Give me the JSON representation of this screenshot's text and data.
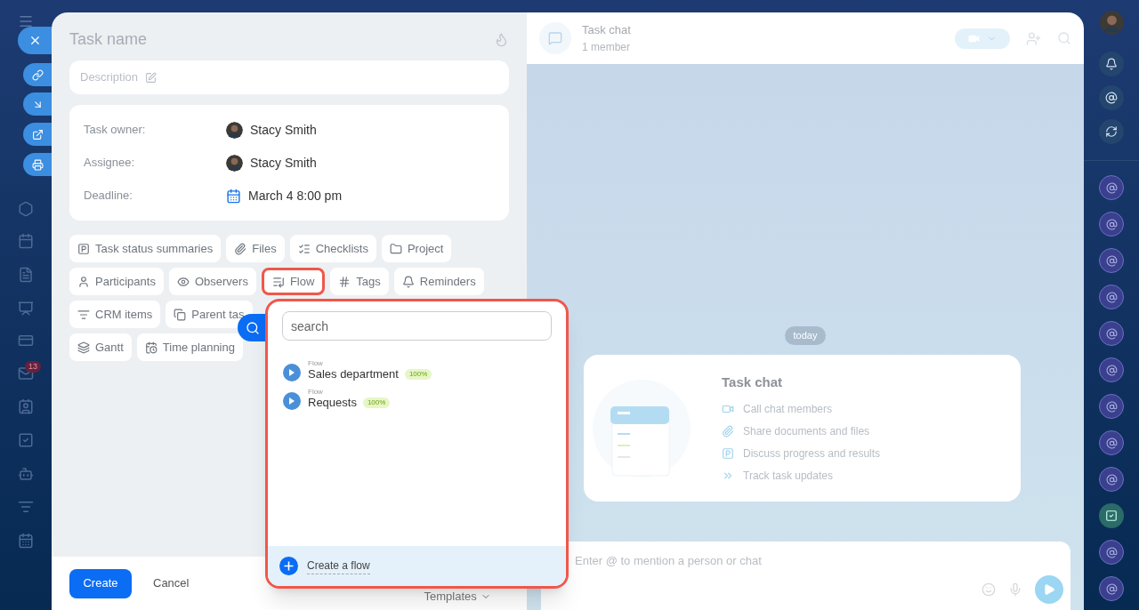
{
  "sidebar": {
    "mail_badge": "13"
  },
  "task": {
    "title_placeholder": "Task name",
    "description_placeholder": "Description",
    "fields": [
      {
        "label": "Task owner:",
        "value": "Stacy Smith",
        "kind": "person"
      },
      {
        "label": "Assignee:",
        "value": "Stacy Smith",
        "kind": "person"
      },
      {
        "label": "Deadline:",
        "value": "March 4 8:00 pm",
        "kind": "date"
      }
    ]
  },
  "chip_rows": [
    [
      {
        "label": "Task status summaries",
        "selected": false
      },
      {
        "label": "Files",
        "selected": false
      },
      {
        "label": "Checklists",
        "selected": false
      },
      {
        "label": "Project",
        "selected": false
      }
    ],
    [
      {
        "label": "Participants",
        "selected": false
      },
      {
        "label": "Observers",
        "selected": false
      },
      {
        "label": "Flow",
        "selected": true
      },
      {
        "label": "Tags",
        "selected": false
      },
      {
        "label": "Reminders",
        "selected": false
      }
    ],
    [
      {
        "label": "CRM items",
        "selected": false
      },
      {
        "label": "Parent tas",
        "selected": false
      }
    ],
    [
      {
        "label": "Gantt",
        "selected": false
      },
      {
        "label": "Time planning",
        "selected": false
      }
    ]
  ],
  "flow_dropdown": {
    "search_placeholder": "search",
    "items": [
      {
        "caption": "Flow",
        "name": "Sales department",
        "badge": "100%"
      },
      {
        "caption": "Flow",
        "name": "Requests",
        "badge": "100%"
      }
    ],
    "create_label": "Create a flow"
  },
  "footer": {
    "create": "Create",
    "cancel": "Cancel",
    "templates": "Templates"
  },
  "chat": {
    "title": "Task chat",
    "subtitle": "1 member",
    "date": "today",
    "intro": {
      "title": "Task chat",
      "features": [
        "Call chat members",
        "Share documents and files",
        "Discuss progress and results",
        "Track task updates"
      ]
    },
    "input_placeholder": "Enter @ to mention a person or chat"
  }
}
